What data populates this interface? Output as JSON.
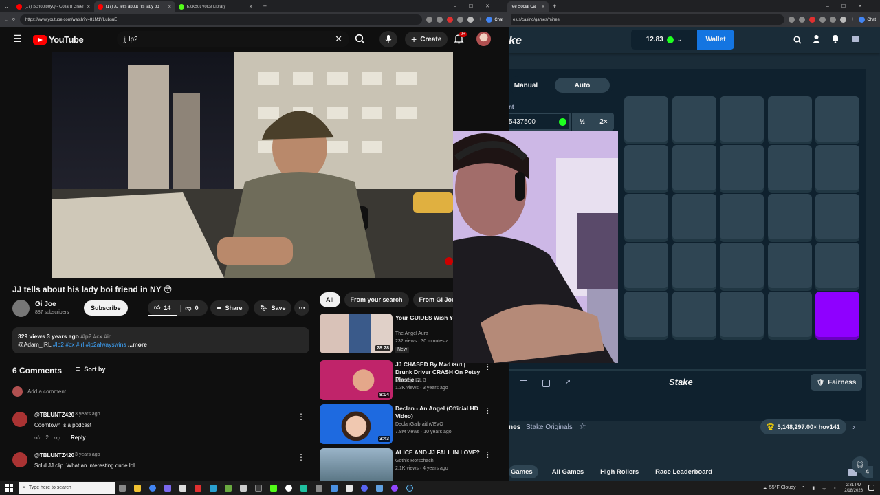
{
  "browser": {
    "left_tabs": [
      {
        "title": "(17) SchoolboyQ - Collard Green",
        "color": "#ff0000"
      },
      {
        "title": "(17) JJ tells about his lady bo",
        "color": "#ff0000"
      },
      {
        "title": "KickBot Voice Library",
        "color": "#53fc18"
      }
    ],
    "left_url": "https://www.youtube.com/watch?v=81M1YLubsuE",
    "right_tabs": [
      {
        "title": "ree Social Ca",
        "color": "#1475e1"
      }
    ],
    "right_url": "e.us/casino/games/mines",
    "chat_label": "Chat"
  },
  "youtube": {
    "logo_text": "YouTube",
    "search_query": "jj lp2",
    "create_label": "Create",
    "notif_count": "9+",
    "video_title": "JJ tells about his lady boi friend in NY 😳",
    "channel_name": "Gi Joe",
    "subscribers": "887 subscribers",
    "subscribe_label": "Subscribe",
    "likes": "14",
    "dislikes": "0",
    "share_label": "Share",
    "save_label": "Save",
    "desc_meta": "329 views  3 years ago",
    "desc_tags": "#lp2 #cx #irl",
    "desc_line2_user": "@Adam_IRL",
    "desc_line2_tags": "#lp2 #cx #irl #ip2alwayswins",
    "desc_more": "...more",
    "comments_count": "6 Comments",
    "sort_label": "Sort by",
    "add_comment_placeholder": "Add a comment...",
    "comments": [
      {
        "author": "@TBLUNTZ420",
        "time": "3 years ago",
        "text": "Coomtown is a podcast",
        "likes": "2",
        "reply": "Reply"
      },
      {
        "author": "@TBLUNTZ420",
        "time": "3 years ago",
        "text": "Solid JJ clip. What an interesting dude lol",
        "likes": "",
        "reply": ""
      }
    ],
    "filter_chips": [
      "All",
      "From your search",
      "From Gi Joe"
    ],
    "suggestions": [
      {
        "title": "Your GUIDES Wish Yo",
        "title2": "",
        "channel": "The Angel Aura",
        "meta": "232 views · 30 minutes a",
        "badge": "New",
        "duration": "28:28",
        "thumb": "#6a5a7a"
      },
      {
        "title": "JJ CHASED By Mad Girl | Drunk Driver CRASH On Petey Plastic...",
        "title2": "",
        "channel": "Nonstop IRL 3",
        "meta": "1.3K views · 3 years ago",
        "badge": "",
        "duration": "8:04",
        "thumb": "#b0306a"
      },
      {
        "title": "Declan - An Angel (Official HD Video)",
        "title2": "",
        "channel": "DeclanGalbraithVEVO",
        "meta": "7.8M views · 10 years ago",
        "badge": "",
        "duration": "3:43",
        "thumb": "#2a6ad0"
      },
      {
        "title": "ALICE AND JJ FALL IN LOVE?",
        "title2": "",
        "channel": "Gothic Rorschach",
        "meta": "2.1K views · 4 years ago",
        "badge": "",
        "duration": "",
        "thumb": "#6a8aa0"
      }
    ]
  },
  "stake": {
    "logo": "ke",
    "balance": "12.83",
    "wallet_label": "Wallet",
    "mode_manual": "Manual",
    "mode_auto": "Auto",
    "amount_label": "nt",
    "bet_amount": "5437500",
    "half_label": "½",
    "double_label": "2×",
    "footer_logo": "Stake",
    "fairness_label": "Fairness",
    "game_name": "nes",
    "game_provider": "Stake Originals",
    "record": "5,148,297.00× hov141",
    "bottom_tabs": [
      "Games",
      "All Games",
      "High Rollers",
      "Race Leaderboard"
    ],
    "bottom_extra": "4",
    "grid": [
      [
        0,
        0,
        0,
        0,
        0
      ],
      [
        0,
        0,
        0,
        0,
        0
      ],
      [
        0,
        0,
        0,
        0,
        0
      ],
      [
        0,
        0,
        0,
        0,
        0
      ],
      [
        0,
        0,
        0,
        0,
        1
      ]
    ]
  },
  "taskbar": {
    "search_placeholder": "Type here to search",
    "weather": "55°F  Cloudy",
    "time": "2:31 PM",
    "date": "2/18/2026"
  },
  "colors": {
    "yt_red": "#ff0000",
    "stake_blue": "#1475e1",
    "stake_green": "#1fff20",
    "gem_purple": "#8f00ff"
  }
}
